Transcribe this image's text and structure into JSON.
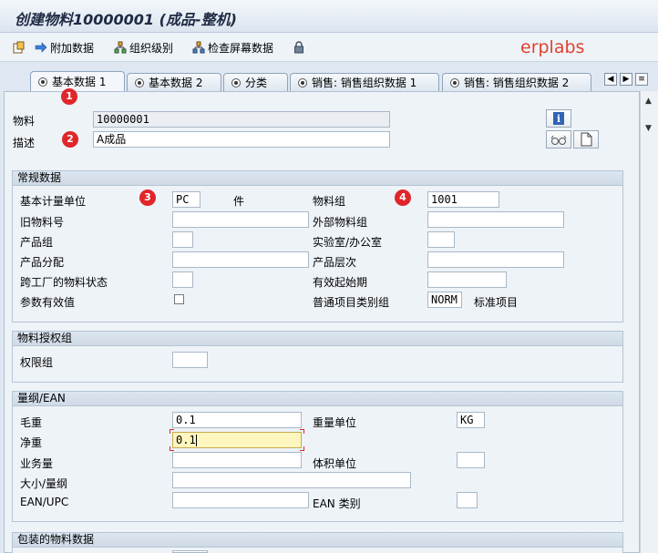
{
  "window": {
    "title": "创建物料10000001 (成品-整机)"
  },
  "toolbar": {
    "additional_data": "附加数据",
    "org_levels": "组织级别",
    "check_screen_data": "检查屏幕数据"
  },
  "brand": "erplabs",
  "tabs": [
    {
      "label": "基本数据 1"
    },
    {
      "label": "基本数据 2"
    },
    {
      "label": "分类"
    },
    {
      "label": "销售: 销售组织数据 1"
    },
    {
      "label": "销售: 销售组织数据 2"
    }
  ],
  "header": {
    "material_label": "物料",
    "material_value": "10000001",
    "description_label": "描述",
    "description_value": "A成品"
  },
  "general": {
    "title": "常规数据",
    "base_uom_label": "基本计量单位",
    "base_uom_value": "PC",
    "base_uom_text": "件",
    "material_group_label": "物料组",
    "material_group_value": "1001",
    "old_material_label": "旧物料号",
    "ext_material_group_label": "外部物料组",
    "division_label": "产品组",
    "lab_office_label": "实验室/办公室",
    "product_allocation_label": "产品分配",
    "product_hierarchy_label": "产品层次",
    "cross_plant_status_label": "跨工厂的物料状态",
    "valid_from_label": "有效起始期",
    "assign_effect_label": "参数有效值",
    "gen_item_cat_label": "普通项目类别组",
    "gen_item_cat_value": "NORM",
    "gen_item_cat_text": "标准项目"
  },
  "auth": {
    "title": "物料授权组",
    "auth_group_label": "权限组"
  },
  "dims": {
    "title": "量纲/EAN",
    "gross_weight_label": "毛重",
    "gross_weight_value": "0.1",
    "weight_unit_label": "重量单位",
    "weight_unit_value": "KG",
    "net_weight_label": "净重",
    "net_weight_value": "0.1",
    "volume_label": "业务量",
    "volume_unit_label": "体积单位",
    "size_dims_label": "大小/量纲",
    "ean_upc_label": "EAN/UPC",
    "ean_category_label": "EAN 类别"
  },
  "packaging": {
    "title": "包装的物料数据"
  },
  "badges": [
    "1",
    "2",
    "3",
    "4"
  ]
}
